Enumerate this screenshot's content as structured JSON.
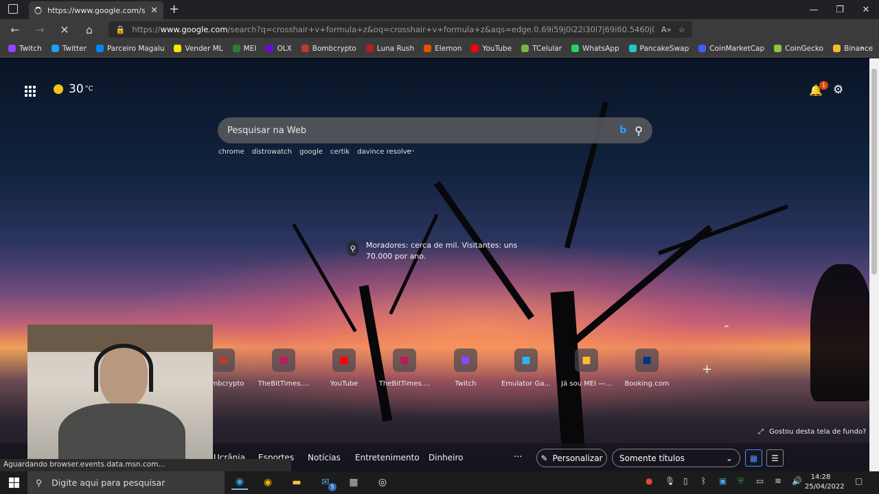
{
  "tabs": [
    {
      "title": "https://www.google.com/search"
    }
  ],
  "address": {
    "scheme": "https://",
    "host": "www.google.com",
    "path": "/search?q=crosshair+v+formula+z&oq=crosshair+v+formula+z&aqs=edge.0.69i59j0i22i30l7j69i60.5460j0j1&sourceid..."
  },
  "bookmarks": [
    {
      "label": "Twitch",
      "color": "#9146ff",
      "icon": "twitch-icon"
    },
    {
      "label": "Twitter",
      "color": "#1da1f2",
      "icon": "twitter-icon"
    },
    {
      "label": "Parceiro Magalu",
      "color": "#0086ff",
      "icon": "magalu-icon"
    },
    {
      "label": "Vender ML",
      "color": "#ffe600",
      "icon": "mercadolivre-icon"
    },
    {
      "label": "MEI",
      "color": "#2e7d32",
      "icon": "mei-icon"
    },
    {
      "label": "OLX",
      "color": "#6e0ad6",
      "icon": "olx-icon"
    },
    {
      "label": "Bombcrypto",
      "color": "#c0392b",
      "icon": "bombcrypto-icon"
    },
    {
      "label": "Luna Rush",
      "color": "#b71c1c",
      "icon": "lunarush-icon"
    },
    {
      "label": "Elemon",
      "color": "#e65100",
      "icon": "elemon-icon"
    },
    {
      "label": "YouTube",
      "color": "#ff0000",
      "icon": "youtube-icon"
    },
    {
      "label": "TCelular",
      "color": "#7cb342",
      "icon": "tcelular-icon"
    },
    {
      "label": "WhatsApp",
      "color": "#25d366",
      "icon": "whatsapp-icon"
    },
    {
      "label": "PancakeSwap",
      "color": "#1fc7d4",
      "icon": "pancakeswap-icon"
    },
    {
      "label": "CoinMarketCap",
      "color": "#3861fb",
      "icon": "coinmarketcap-icon"
    },
    {
      "label": "CoinGecko",
      "color": "#8dc63f",
      "icon": "coingecko-icon"
    },
    {
      "label": "Binance",
      "color": "#f3ba2f",
      "icon": "binance-icon"
    }
  ],
  "weather": {
    "temp": "30",
    "unit": "°C"
  },
  "notifications": {
    "count": "1"
  },
  "search": {
    "placeholder": "Pesquisar na Web"
  },
  "quick_searches": [
    "chrome",
    "distrowatch",
    "google",
    "certik",
    "davince resolve"
  ],
  "caption": "Moradores: cerca de mil. Visitantes: uns 70.000 por ano.",
  "tiles": [
    {
      "label": "Bombcrypto",
      "icon": "bombcrypto-icon",
      "color": "#c0392b"
    },
    {
      "label": "TheBitTimes....",
      "icon": "bittimes-icon",
      "color": "#c2185b"
    },
    {
      "label": "YouTube",
      "icon": "youtube-icon",
      "color": "#ff0000"
    },
    {
      "label": "TheBitTimes....",
      "icon": "bittimes-icon",
      "color": "#c2185b"
    },
    {
      "label": "Twitch",
      "icon": "twitch-icon",
      "color": "#9146ff"
    },
    {
      "label": "Emulator Ga...",
      "icon": "emulator-icon",
      "color": "#29b6f6"
    },
    {
      "label": "Já sou MEI —...",
      "icon": "mei-icon",
      "color": "#fbc02d"
    },
    {
      "label": "Booking.com",
      "icon": "booking-icon",
      "color": "#003580"
    }
  ],
  "like_background": "Gostou desta tela de fundo?",
  "feed_tabs": [
    "Ucrânia",
    "Esportes",
    "Notícias",
    "Entretenimento",
    "Dinheiro"
  ],
  "personalizar": "Personalizar",
  "layout_select": "Somente títulos",
  "status": "Aguardando browser.events.data.msn.com...",
  "taskbar": {
    "search_placeholder": "Digite aqui para pesquisar",
    "time": "14:28",
    "date": "25/04/2022",
    "badge": "5"
  }
}
